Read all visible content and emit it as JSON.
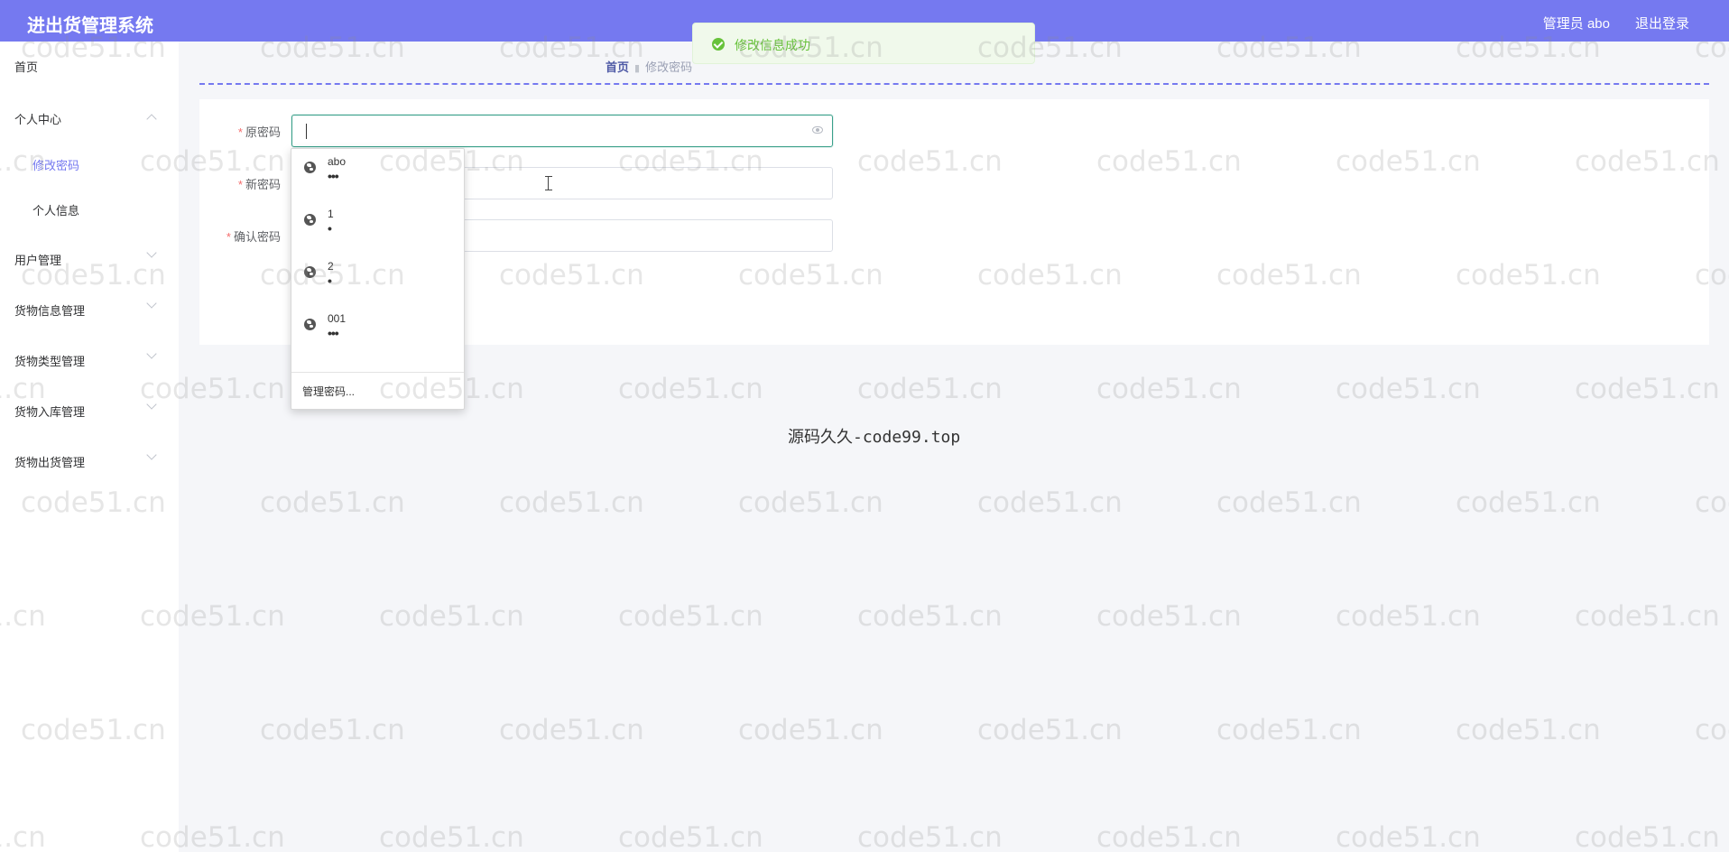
{
  "header": {
    "title": "进出货管理系统",
    "user": "管理员 abo",
    "logout": "退出登录",
    "accent_color": "#7579f0"
  },
  "sidebar": {
    "items": [
      {
        "label": "首页"
      },
      {
        "label": "个人中心",
        "expanded": true
      },
      {
        "label": "修改密码",
        "sub": true,
        "active": true
      },
      {
        "label": "个人信息",
        "sub": true
      },
      {
        "label": "用户管理"
      },
      {
        "label": "货物信息管理"
      },
      {
        "label": "货物类型管理"
      },
      {
        "label": "货物入库管理"
      },
      {
        "label": "货物出货管理"
      }
    ]
  },
  "breadcrumb": {
    "home": "首页",
    "current": "修改密码"
  },
  "form": {
    "fields": [
      {
        "label": "原密码",
        "required": true,
        "value": ""
      },
      {
        "label": "新密码",
        "required": true,
        "value": ""
      },
      {
        "label": "确认密码",
        "required": true,
        "value": ""
      }
    ]
  },
  "autocomplete": {
    "items": [
      {
        "name": "abo",
        "mask": "•••"
      },
      {
        "name": "1",
        "mask": "•"
      },
      {
        "name": "2",
        "mask": "•"
      },
      {
        "name": "001",
        "mask": "•••"
      }
    ],
    "manage": "管理密码..."
  },
  "toast": {
    "message": "修改信息成功",
    "color": "#67c23a"
  },
  "footer": "源码久久-code99.top",
  "watermark": "code51.cn"
}
